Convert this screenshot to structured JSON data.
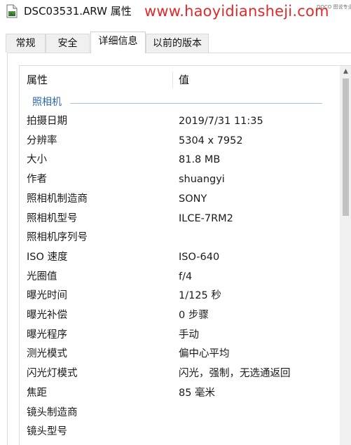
{
  "window": {
    "title": "DSC03531.ARW 属性",
    "watermark": "www.haoyidiansheji.com",
    "watermark_badge": "DOCO 图说专业"
  },
  "icons": {
    "title": "file-icon"
  },
  "tabs": [
    {
      "label": "常规",
      "active": false
    },
    {
      "label": "安全",
      "active": false
    },
    {
      "label": "详细信息",
      "active": true
    },
    {
      "label": "以前的版本",
      "active": false
    }
  ],
  "table": {
    "headers": {
      "name": "属性",
      "value": "值"
    },
    "group": "照相机",
    "rows": [
      {
        "name": "拍摄日期",
        "value": "2019/7/31 11:35"
      },
      {
        "name": "分辨率",
        "value": "5304 x 7952"
      },
      {
        "name": "大小",
        "value": "81.8 MB"
      },
      {
        "name": "作者",
        "value": "shuangyi"
      },
      {
        "name": "照相机制造商",
        "value": "SONY"
      },
      {
        "name": "照相机型号",
        "value": "ILCE-7RM2"
      },
      {
        "name": "照相机序列号",
        "value": ""
      },
      {
        "name": "ISO 速度",
        "value": "ISO-640"
      },
      {
        "name": "光圈值",
        "value": "f/4"
      },
      {
        "name": "曝光时间",
        "value": "1/125 秒"
      },
      {
        "name": "曝光补偿",
        "value": "0 步骤"
      },
      {
        "name": "曝光程序",
        "value": "手动"
      },
      {
        "name": "测光模式",
        "value": "偏中心平均"
      },
      {
        "name": "闪光灯模式",
        "value": "闪光，强制，无选通返回"
      },
      {
        "name": "焦距",
        "value": "85 毫米"
      },
      {
        "name": "镜头制造商",
        "value": ""
      },
      {
        "name": "镜头型号",
        "value": ""
      }
    ]
  },
  "colors": {
    "watermark": "#e02a2a",
    "group_label": "#2b66b5",
    "group_line": "#a9c1e2"
  }
}
